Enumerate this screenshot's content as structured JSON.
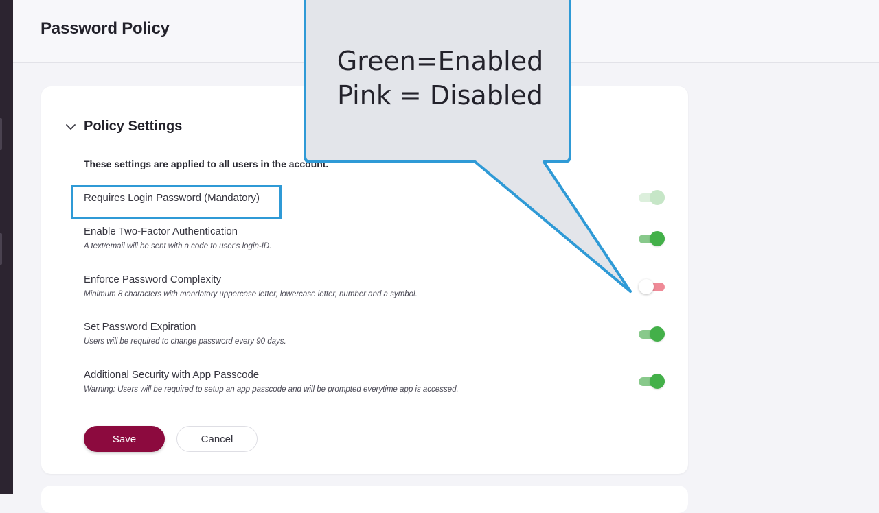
{
  "page": {
    "title": "Password Policy"
  },
  "section": {
    "title": "Policy Settings",
    "description": "These settings are applied to all users in the account."
  },
  "settings": [
    {
      "label": "Requires Login Password (Mandatory)",
      "hint": "",
      "state": "on-disabled"
    },
    {
      "label": "Enable Two-Factor Authentication",
      "hint": "A text/email will be sent with a code to user's login-ID.",
      "state": "on"
    },
    {
      "label": "Enforce Password Complexity",
      "hint": "Minimum 8 characters with mandatory uppercase letter, lowercase letter, number and a symbol.",
      "state": "off"
    },
    {
      "label": "Set Password Expiration",
      "hint": "Users will be required to change password every 90 days.",
      "state": "on"
    },
    {
      "label": "Additional Security with App Passcode",
      "hint": "Warning: Users will be required to setup an app passcode and will be prompted everytime app is accessed.",
      "state": "on"
    }
  ],
  "actions": {
    "save_label": "Save",
    "cancel_label": "Cancel"
  },
  "annotation": {
    "line1": "Green=Enabled",
    "line2": "Pink = Disabled"
  },
  "icons": {
    "section_toggle": "chevron-down-icon"
  },
  "colors": {
    "enabled": "#43b049",
    "disabled": "#ef8a97",
    "save_button": "#8c0a3e",
    "callout_border": "#2f9ad6"
  }
}
